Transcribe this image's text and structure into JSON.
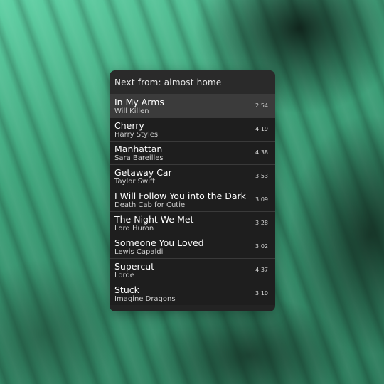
{
  "queue": {
    "header": "Next from: almost home",
    "tracks": [
      {
        "title": "In My Arms",
        "artist": "Will Killen",
        "duration": "2:54",
        "current": true
      },
      {
        "title": "Cherry",
        "artist": "Harry Styles",
        "duration": "4:19"
      },
      {
        "title": "Manhattan",
        "artist": "Sara Bareilles",
        "duration": "4:38"
      },
      {
        "title": "Getaway Car",
        "artist": "Taylor Swift",
        "duration": "3:53"
      },
      {
        "title": "I Will Follow You into the Dark",
        "artist": "Death Cab for Cutie",
        "duration": "3:09"
      },
      {
        "title": "The Night We Met",
        "artist": "Lord Huron",
        "duration": "3:28"
      },
      {
        "title": "Someone You Loved",
        "artist": "Lewis Capaldi",
        "duration": "3:02"
      },
      {
        "title": "Supercut",
        "artist": "Lorde",
        "duration": "4:37"
      },
      {
        "title": "Stuck",
        "artist": "Imagine Dragons",
        "duration": "3:10"
      }
    ]
  },
  "colors": {
    "background_accent": "#3fa57c",
    "panel": "#232323",
    "current_row": "#3b3b3b"
  }
}
